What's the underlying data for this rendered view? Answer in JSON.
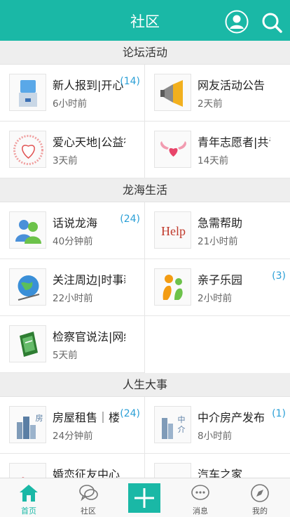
{
  "header": {
    "title": "社区",
    "user_icon": "user-icon",
    "search_icon": "search-icon"
  },
  "colors": {
    "accent": "#1ab8a6",
    "count": "#2a9fd6"
  },
  "sections": [
    {
      "title": "论坛活动",
      "items": [
        {
          "name": "新人报到|开心",
          "time": "6小时前",
          "count": "(14)",
          "icon": "water-dispenser-icon"
        },
        {
          "name": "网友活动公告",
          "time": "2天前",
          "count": "",
          "icon": "megaphone-icon"
        },
        {
          "name": "爱心天地|公益行",
          "time": "3天前",
          "count": "",
          "icon": "heart-icon"
        },
        {
          "name": "青年志愿者|共青",
          "time": "14天前",
          "count": "",
          "icon": "winged-heart-icon"
        }
      ]
    },
    {
      "title": "龙海生活",
      "items": [
        {
          "name": "话说龙海",
          "time": "40分钟前",
          "count": "(24)",
          "icon": "people-chat-icon"
        },
        {
          "name": "急需帮助",
          "time": "21小时前",
          "count": "",
          "icon": "help-text-icon"
        },
        {
          "name": "关注周边|时事新",
          "time": "22小时前",
          "count": "",
          "icon": "globe-icon"
        },
        {
          "name": "亲子乐园",
          "time": "2小时前",
          "count": "(3)",
          "icon": "parent-child-icon"
        },
        {
          "name": "检察官说法|网络",
          "time": "5天前",
          "count": "",
          "icon": "law-book-icon"
        }
      ]
    },
    {
      "title": "人生大事",
      "items": [
        {
          "name": "房屋租售｜楼",
          "time": "24分钟前",
          "count": "(24)",
          "icon": "buildings-icon"
        },
        {
          "name": "中介房产发布",
          "time": "8小时前",
          "count": "(1)",
          "icon": "agency-building-icon"
        },
        {
          "name": "婚恋征友中心",
          "time": "",
          "count": "",
          "icon": "love-icon"
        },
        {
          "name": "汽车之家",
          "time": "",
          "count": "",
          "icon": "car-icon"
        }
      ]
    }
  ],
  "help_text": "Help",
  "agency_text": "中介",
  "house_text": "房",
  "tabs": [
    {
      "label": "首页",
      "icon": "home-icon",
      "active": true
    },
    {
      "label": "社区",
      "icon": "chat-bubbles-icon"
    },
    {
      "label": "",
      "icon": "add-icon"
    },
    {
      "label": "消息",
      "icon": "message-icon"
    },
    {
      "label": "我的",
      "icon": "compass-icon"
    }
  ]
}
